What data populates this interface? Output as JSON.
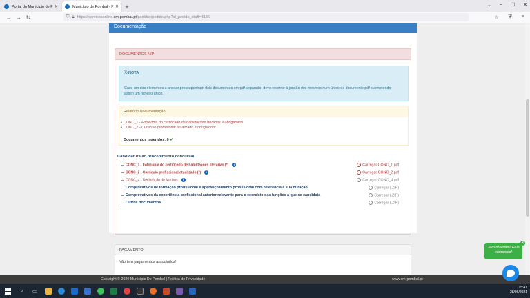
{
  "browser": {
    "tabs": [
      {
        "label": "Portal do Município de Pombal",
        "active": false
      },
      {
        "label": "Município de Pombal - Pedido",
        "active": true
      }
    ],
    "url_prefix": "https://servicosonline.",
    "url_host": "cm-pombal.pt",
    "url_suffix": "/pedidos/pedido.php?id_pedido_draft=8136"
  },
  "page": {
    "panel_title": "Documentação",
    "doc_nip_header": "DOCUMENTOS NIP",
    "nota_title": "NOTA",
    "nota_body": "Caso um dos elementos a anexar pressuponham dois documentos em pdf separado, deve recorrer à junção dos mesmos num único de documento pdf submetendo assim um ficheiro único.",
    "relatorio_header": "Relatório Documentação",
    "relatorio_items": [
      {
        "code": "CONC_1",
        "text": "- Fotocópia do certificado de habilitações literárias é obrigatório!"
      },
      {
        "code": "CONC_2",
        "text": "- Curriculo profissional atualizado é obrigatório!"
      }
    ],
    "docs_inseridos_label": "Documentos inseridos: 0",
    "candidatura_title": "Candidatura ao procedimento concursal",
    "candidatura_rows": [
      {
        "label": "CONC_1 - Fotocópia do certificado de habilitações literárias (*)",
        "action": "Carregar CONC_1.pdf",
        "required": true,
        "info": true
      },
      {
        "label": "CONC_2 - Curriculo profissional atualizado (*)",
        "action": "Carregar CONC_2.pdf",
        "required": true,
        "info": true
      },
      {
        "label": "CONC_4 - Declaração de Motivos",
        "action": "Carregar CONC_4.pdf",
        "required": true,
        "info": true
      },
      {
        "label": "Comprovativos de formação profissional e aperfeiçoamento profissional com referência à sua duração",
        "action": "Carregar (.ZIP)",
        "required": false,
        "info": false
      },
      {
        "label": "Comprovativos da experiência profissional anterior relevante para o exercício das funções a que se candidata",
        "action": "Carregar (.ZIP)",
        "required": false,
        "info": false
      },
      {
        "label": "Outros documentos",
        "action": "Carregar (.ZIP)",
        "required": false,
        "info": false
      }
    ],
    "pagamento_header": "PAGAMENTO",
    "pagamento_body": "Não tem pagamentos associados!"
  },
  "footer": {
    "copyright": "Copyright © 2020 Município De Pombal | Política de Privacidade",
    "site": "www.cm-pombal.pt"
  },
  "chat": {
    "bubble": "Tem dúvidas? Fale connosco!"
  },
  "taskbar": {
    "time": "15:41",
    "date": "28/06/2021"
  },
  "colors": {
    "panel_blue": "#3a7fc4",
    "danger_red": "#a94442",
    "chat_green": "#3cb044"
  }
}
